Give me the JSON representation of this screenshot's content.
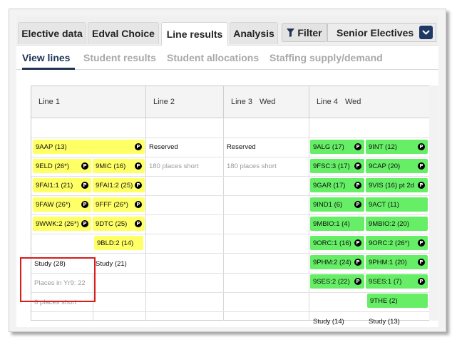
{
  "tabs": {
    "items": [
      "Elective data",
      "Edval Choice",
      "Line results",
      "Analysis"
    ],
    "active": "Line results"
  },
  "filter": {
    "label": "Filter",
    "icon": "filter-icon"
  },
  "select": {
    "value": "Senior Electives",
    "icon": "chevron-down-icon"
  },
  "subtabs": {
    "items": [
      "View lines",
      "Student results",
      "Student allocations",
      "Staffing supply/demand"
    ],
    "active": "View lines"
  },
  "lines": {
    "headers": [
      {
        "name": "Line 1",
        "day": ""
      },
      {
        "name": "Line 2",
        "day": ""
      },
      {
        "name": "Line 3",
        "day": "Wed"
      },
      {
        "name": "Line 4",
        "day": "Wed"
      }
    ],
    "line1": {
      "row1": [
        {
          "text": "9AAP (13)",
          "p": true
        }
      ],
      "row2": [
        {
          "text": "9ELD (26*)",
          "p": true
        },
        {
          "text": "9MIC (16)",
          "p": true
        }
      ],
      "row3": [
        {
          "text": "9FAI1:1 (21)",
          "p": true
        },
        {
          "text": "9FAI1:2 (25)",
          "p": true
        }
      ],
      "row4": [
        {
          "text": "9FAW (26*)",
          "p": true
        },
        {
          "text": "9FFF (26*)",
          "p": true
        }
      ],
      "row5": [
        {
          "text": "9WWK:2 (26*)",
          "p": true
        },
        {
          "text": "9DTC (25)",
          "p": true
        }
      ],
      "row6": [
        {
          "text": "9BLD:2 (14)",
          "p": false
        }
      ],
      "study": [
        "Study (28)",
        "Study (21)"
      ],
      "places": "Places in Yr9: 22",
      "short": "6 places short"
    },
    "line2": {
      "reserved": "Reserved",
      "short": "180 places short"
    },
    "line3": {
      "reserved": "Reserved",
      "short": "180 places short"
    },
    "line4": {
      "colA": [
        {
          "text": "9ALG (17)",
          "p": true
        },
        {
          "text": "9FSC:3 (17)",
          "p": true
        },
        {
          "text": "9GAR (17)",
          "p": true
        },
        {
          "text": "9IND1 (6)",
          "p": true
        },
        {
          "text": "9MBIO:1 (4)",
          "p": false
        },
        {
          "text": "9ORC:1 (16)",
          "p": true
        },
        {
          "text": "9PHM:2 (24)",
          "p": true
        },
        {
          "text": "9SES:2 (22)",
          "p": true
        }
      ],
      "colB": [
        {
          "text": "9INT (12)",
          "p": true
        },
        {
          "text": "9CAP (20)",
          "p": true
        },
        {
          "text": "9VIS (16) pt 2d",
          "p": true
        },
        {
          "text": "9ACT (11)",
          "p": false
        },
        {
          "text": "9MBIO:2 (20)",
          "p": false
        },
        {
          "text": "9ORC:2 (26*)",
          "p": true
        },
        {
          "text": "9PHM:1 (20)",
          "p": true
        },
        {
          "text": "9SES:1 (7)",
          "p": true
        },
        {
          "text": "9THE (2)",
          "p": false
        }
      ],
      "study": [
        "Study (14)",
        "Study (13)"
      ]
    }
  },
  "colors": {
    "yellow": "#ffff66",
    "green": "#66ee66",
    "accent": "#1f3355",
    "highlight": "#d81b1b"
  }
}
